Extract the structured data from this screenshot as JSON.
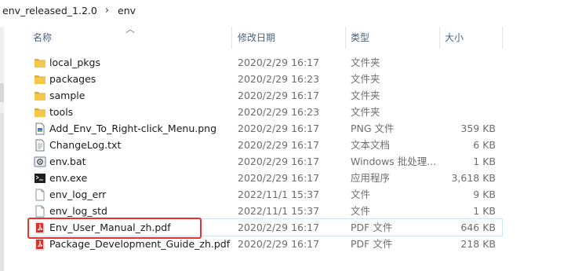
{
  "breadcrumb": {
    "parent": "env_released_1.2.0",
    "separator": "›",
    "current": "env"
  },
  "columns": {
    "name": "名称",
    "date": "修改日期",
    "type": "类型",
    "size": "大小"
  },
  "files": [
    {
      "icon": "folder-icon",
      "name": "local_pkgs",
      "date": "2020/2/29 16:17",
      "type": "文件夹",
      "size": ""
    },
    {
      "icon": "folder-icon",
      "name": "packages",
      "date": "2020/2/29 16:23",
      "type": "文件夹",
      "size": ""
    },
    {
      "icon": "folder-icon",
      "name": "sample",
      "date": "2020/2/29 16:17",
      "type": "文件夹",
      "size": ""
    },
    {
      "icon": "folder-icon",
      "name": "tools",
      "date": "2020/2/29 16:23",
      "type": "文件夹",
      "size": ""
    },
    {
      "icon": "png-file-icon",
      "name": "Add_Env_To_Right-click_Menu.png",
      "date": "2020/2/29 16:17",
      "type": "PNG 文件",
      "size": "359 KB"
    },
    {
      "icon": "text-file-icon",
      "name": "ChangeLog.txt",
      "date": "2020/2/29 16:17",
      "type": "文本文档",
      "size": "6 KB"
    },
    {
      "icon": "bat-file-icon",
      "name": "env.bat",
      "date": "2020/2/29 16:17",
      "type": "Windows 批处理...",
      "size": "1 KB"
    },
    {
      "icon": "exe-file-icon",
      "name": "env.exe",
      "date": "2020/2/29 16:17",
      "type": "应用程序",
      "size": "3,618 KB"
    },
    {
      "icon": "blank-file-icon",
      "name": "env_log_err",
      "date": "2022/11/1 15:37",
      "type": "文件",
      "size": "9 KB"
    },
    {
      "icon": "blank-file-icon",
      "name": "env_log_std",
      "date": "2022/11/1 15:37",
      "type": "文件",
      "size": "1 KB"
    },
    {
      "icon": "pdf-file-icon",
      "name": "Env_User_Manual_zh.pdf",
      "date": "2020/2/29 16:17",
      "type": "PDF 文件",
      "size": "646 KB",
      "highlighted": true
    },
    {
      "icon": "pdf-file-icon",
      "name": "Package_Development_Guide_zh.pdf",
      "date": "2020/2/29 16:17",
      "type": "PDF 文件",
      "size": "218 KB"
    }
  ],
  "colors": {
    "annotation": "#e8332e",
    "folder": "#f4c94b",
    "pdf": "#d9322c"
  }
}
